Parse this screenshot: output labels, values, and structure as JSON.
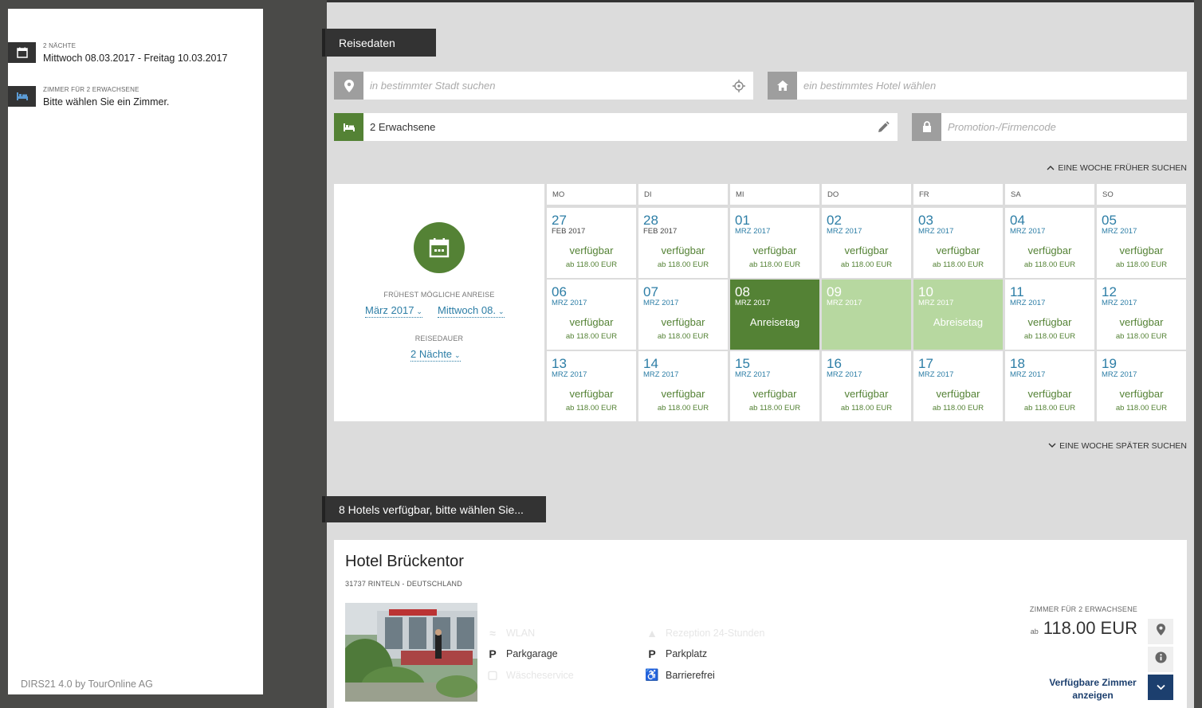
{
  "sidebar": {
    "nights_label": "2 NÄCHTE",
    "dates": "Mittwoch 08.03.2017 - Freitag 10.03.2017",
    "room_label": "ZIMMER FÜR 2 ERWACHSENE",
    "room_prompt": "Bitte wählen Sie ein Zimmer.",
    "footer": "DIRS21 4.0 by TourOnline AG"
  },
  "search": {
    "section_title": "Reisedaten",
    "city_placeholder": "in bestimmter Stadt suchen",
    "hotel_placeholder": "ein bestimmtes Hotel wählen",
    "guests_value": "2 Erwachsene",
    "promo_placeholder": "Promotion-/Firmencode",
    "earlier_week": "EINE WOCHE FRÜHER SUCHEN",
    "later_week": "EINE WOCHE SPÄTER SUCHEN"
  },
  "calendar": {
    "earliest_label": "FRÜHEST MÖGLICHE ANREISE",
    "month_select": "März 2017",
    "day_select": "Mittwoch 08.",
    "duration_label": "REISEDAUER",
    "duration_select": "2 Nächte",
    "weekdays": [
      "MO",
      "DI",
      "MI",
      "DO",
      "FR",
      "SA",
      "SO"
    ],
    "weeks": [
      [
        {
          "num": "27",
          "mon": "FEB 2017",
          "status": "verfügbar",
          "price": "ab 118.00 EUR",
          "state": "available"
        },
        {
          "num": "28",
          "mon": "FEB 2017",
          "status": "verfügbar",
          "price": "ab 118.00 EUR",
          "state": "available"
        },
        {
          "num": "01",
          "mon": "MRZ 2017",
          "status": "verfügbar",
          "price": "ab 118.00 EUR",
          "state": "available"
        },
        {
          "num": "02",
          "mon": "MRZ 2017",
          "status": "verfügbar",
          "price": "ab 118.00 EUR",
          "state": "available"
        },
        {
          "num": "03",
          "mon": "MRZ 2017",
          "status": "verfügbar",
          "price": "ab 118.00 EUR",
          "state": "available"
        },
        {
          "num": "04",
          "mon": "MRZ 2017",
          "status": "verfügbar",
          "price": "ab 118.00 EUR",
          "state": "available"
        },
        {
          "num": "05",
          "mon": "MRZ 2017",
          "status": "verfügbar",
          "price": "ab 118.00 EUR",
          "state": "available"
        }
      ],
      [
        {
          "num": "06",
          "mon": "MRZ 2017",
          "status": "verfügbar",
          "price": "ab 118.00 EUR",
          "state": "available"
        },
        {
          "num": "07",
          "mon": "MRZ 2017",
          "status": "verfügbar",
          "price": "ab 118.00 EUR",
          "state": "available"
        },
        {
          "num": "08",
          "mon": "MRZ 2017",
          "status": "Anreisetag",
          "price": "",
          "state": "arrival"
        },
        {
          "num": "09",
          "mon": "MRZ 2017",
          "status": "",
          "price": "",
          "state": "stay"
        },
        {
          "num": "10",
          "mon": "MRZ 2017",
          "status": "Abreisetag",
          "price": "",
          "state": "stay"
        },
        {
          "num": "11",
          "mon": "MRZ 2017",
          "status": "verfügbar",
          "price": "ab 118.00 EUR",
          "state": "available"
        },
        {
          "num": "12",
          "mon": "MRZ 2017",
          "status": "verfügbar",
          "price": "ab 118.00 EUR",
          "state": "available"
        }
      ],
      [
        {
          "num": "13",
          "mon": "MRZ 2017",
          "status": "verfügbar",
          "price": "ab 118.00 EUR",
          "state": "available"
        },
        {
          "num": "14",
          "mon": "MRZ 2017",
          "status": "verfügbar",
          "price": "ab 118.00 EUR",
          "state": "available"
        },
        {
          "num": "15",
          "mon": "MRZ 2017",
          "status": "verfügbar",
          "price": "ab 118.00 EUR",
          "state": "available"
        },
        {
          "num": "16",
          "mon": "MRZ 2017",
          "status": "verfügbar",
          "price": "ab 118.00 EUR",
          "state": "available"
        },
        {
          "num": "17",
          "mon": "MRZ 2017",
          "status": "verfügbar",
          "price": "ab 118.00 EUR",
          "state": "available"
        },
        {
          "num": "18",
          "mon": "MRZ 2017",
          "status": "verfügbar",
          "price": "ab 118.00 EUR",
          "state": "available"
        },
        {
          "num": "19",
          "mon": "MRZ 2017",
          "status": "verfügbar",
          "price": "ab 118.00 EUR",
          "state": "available"
        }
      ]
    ]
  },
  "results": {
    "section_title": "8 Hotels verfügbar, bitte wählen Sie...",
    "hotel": {
      "name": "Hotel Brückentor",
      "address": "31737 RINTELN - DEUTSCHLAND",
      "amenities": [
        {
          "icon": "wifi-icon",
          "label": "WLAN",
          "faded": true
        },
        {
          "icon": "reception-icon",
          "label": "Rezeption 24-Stunden",
          "faded": true
        },
        {
          "icon": "parking-icon",
          "label": "Parkgarage",
          "faded": false
        },
        {
          "icon": "parking-icon",
          "label": "Parkplatz",
          "faded": false
        },
        {
          "icon": "laundry-icon",
          "label": "Wäscheservice",
          "faded": true
        },
        {
          "icon": "wheelchair-icon",
          "label": "Barrierefrei",
          "faded": false
        }
      ],
      "room_label": "ZIMMER FÜR 2 ERWACHSENE",
      "price_prefix": "ab",
      "price": "118.00 EUR",
      "avail_link": "Verfügbare Zimmer anzeigen"
    }
  },
  "colors": {
    "green": "#548235",
    "light_green": "#b7d8a0",
    "link_blue": "#2d7ea6",
    "navy": "#1c3f6e"
  }
}
